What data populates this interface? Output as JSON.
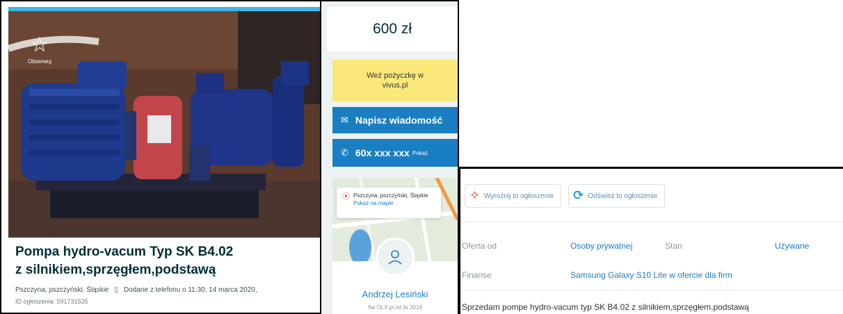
{
  "ad": {
    "follow_label": "Obserwuj",
    "title": "Pompa hydro-vacum Typ SK B4.02 z silnikiem,sprzęgłem,podstawą",
    "location": "Pszczyna, pszczyński, Śląskie",
    "added": "Dodane z telefonu o 11:30, 14 marca 2020,",
    "ad_id": "ID ogłoszenia: 591731525"
  },
  "contact": {
    "price": "600 zł",
    "loan_label": "Weź pożyczkę w vivus.pl",
    "message_label": "Napisz wiadomość",
    "phone_number": "60x xxx xxx",
    "phone_show": "Pokaż",
    "map_location": "Pszczyna, pszczyński, Śląskie",
    "map_link": "Pokaż na mapie",
    "seller_name": "Andrzej Lesiński",
    "seller_since": "Na OLX.pl od lis 2014"
  },
  "details": {
    "highlight_label": "Wyróżnij to ogłoszenie",
    "refresh_label": "Odśwież to ogłoszenie",
    "offer_from_label": "Oferta od",
    "offer_from_value": "Osoby prywatnej",
    "condition_label": "Stan",
    "condition_value": "Używane",
    "finance_label": "Finanse",
    "finance_value": "Samsung Galaxy S10 Lite w ofercie dla firm",
    "description": "Sprzedam pompe hydro-vacum typ SK B4.02 z silnikiem,sprzęgłem,podstawą"
  },
  "colors": {
    "accent_blue": "#1a7ec2",
    "loan_yellow": "#fbe87a",
    "text_dark": "#002f34",
    "pump_blue": "#1d3a8c",
    "coupling_red": "#c2454c"
  },
  "icons": {
    "follow": "star-icon",
    "message": "envelope-icon",
    "phone": "phone-icon",
    "map_pin": "location-pin-icon",
    "avatar": "user-icon",
    "highlight": "kite-icon",
    "refresh": "refresh-icon",
    "date": "calendar-icon"
  }
}
